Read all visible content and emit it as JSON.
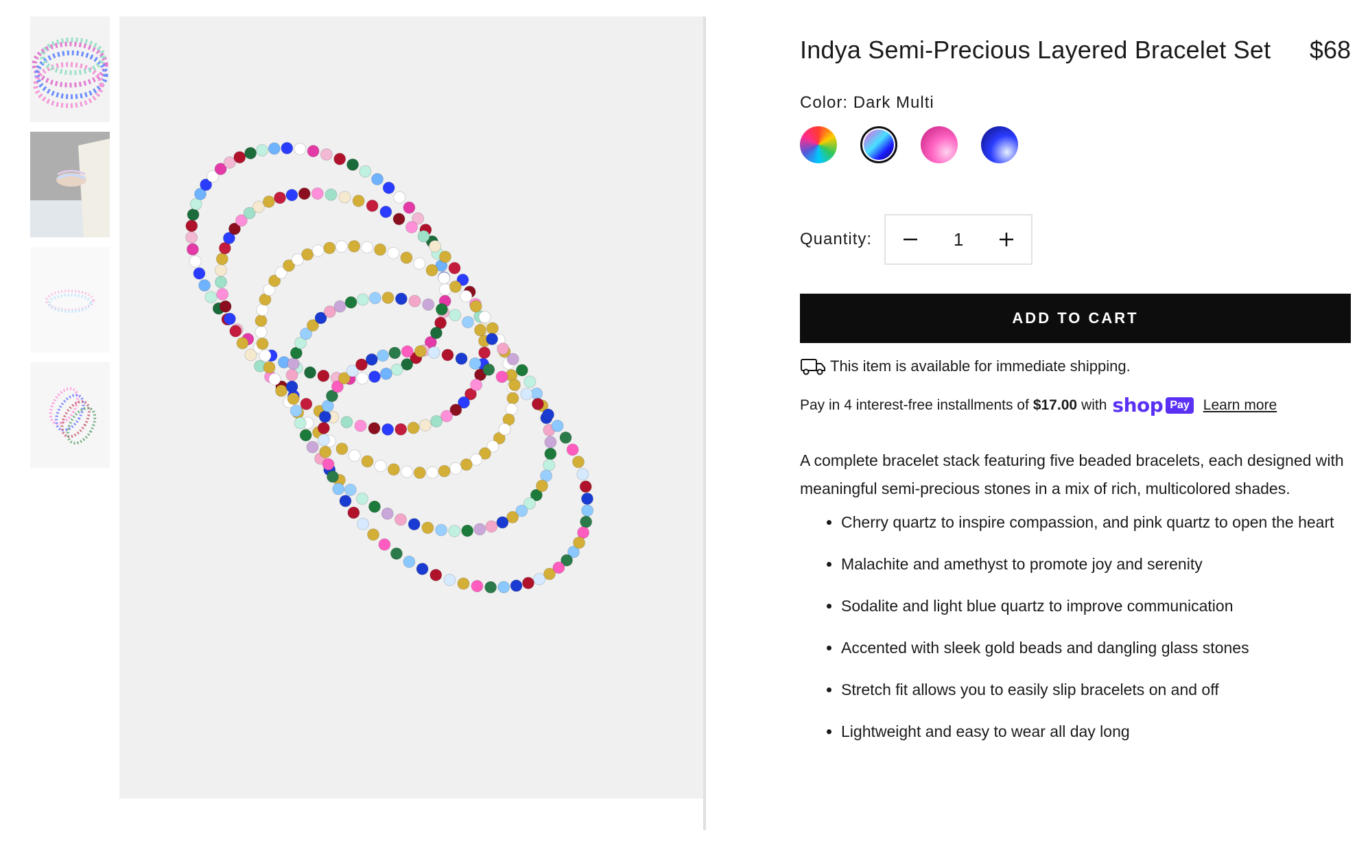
{
  "thumbnails": [
    {
      "alt": "bracelet-stack-closeup"
    },
    {
      "alt": "bracelets-on-wrist"
    },
    {
      "alt": "bracelets-small"
    },
    {
      "alt": "bracelets-flatlay"
    }
  ],
  "product": {
    "title": "Indya Semi-Precious Layered Bracelet Set",
    "price": "$68",
    "color_label": "Color: Dark Multi",
    "swatches": [
      {
        "name": "Multi",
        "selected": false
      },
      {
        "name": "Dark Multi",
        "selected": true
      },
      {
        "name": "Pink",
        "selected": false
      },
      {
        "name": "Blue",
        "selected": false
      }
    ],
    "quantity_label": "Quantity:",
    "quantity": "1",
    "add_to_cart": "ADD TO CART",
    "shipping_text": "This item is available for immediate shipping.",
    "installments": {
      "prefix": "Pay in 4 interest-free installments of",
      "amount": "$17.00",
      "suffix": "with",
      "shop": "shop",
      "pay": "Pay",
      "learn_more": "Learn more"
    },
    "description": "A complete bracelet stack featuring five beaded bracelets, each designed with meaningful semi-precious stones in a mix of rich, multicolored shades.",
    "features": [
      "Cherry quartz to inspire compassion, and pink quartz to open the heart",
      "Malachite and amethyst to promote joy and serenity",
      "Sodalite and light blue quartz to improve communication",
      "Accented with sleek gold beads and dangling glass stones",
      "Stretch fit allows you to easily slip bracelets on and off",
      "Lightweight and easy to wear all day long"
    ]
  },
  "colors": {
    "button_bg": "#0d0d0d",
    "shop_pay": "#5a31f4",
    "image_bg": "#f0f0f0"
  }
}
